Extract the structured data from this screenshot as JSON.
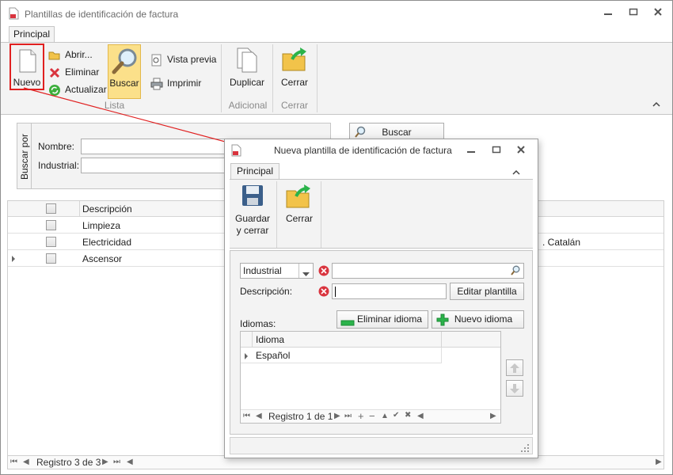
{
  "window": {
    "title": "Plantillas de identificación de factura"
  },
  "ribbon": {
    "tab": "Principal",
    "nuevo": "Nuevo",
    "abrir": "Abrir...",
    "eliminar": "Eliminar",
    "actualizar": "Actualizar",
    "buscar": "Buscar",
    "vista_previa": "Vista previa",
    "imprimir": "Imprimir",
    "duplicar": "Duplicar",
    "cerrar": "Cerrar",
    "group_lista": "Lista",
    "group_adicional": "Adicional",
    "group_cerrar": "Cerrar"
  },
  "search_panel": {
    "vertical_label": "Buscar por",
    "nombre_label": "Nombre:",
    "industrial_label": "Industrial:",
    "buscar_button": "Buscar",
    "nombre_value": "",
    "industrial_value": ""
  },
  "grid": {
    "header_descripcion": "Descripción",
    "rows": [
      {
        "descripcion": "Limpieza",
        "extra": ""
      },
      {
        "descripcion": "Electricidad",
        "extra": ". Catalán"
      },
      {
        "descripcion": "Ascensor",
        "extra": ""
      }
    ],
    "nav_text": "Registro 3 de 3"
  },
  "dialog": {
    "title": "Nueva plantilla de identificación de factura",
    "tab": "Principal",
    "guardar": "Guardar\ny cerrar",
    "cerrar": "Cerrar",
    "industrial_select": "Industrial",
    "descripcion_label": "Descripción:",
    "editar_plantilla": "Editar plantilla",
    "idiomas_label": "Idiomas:",
    "eliminar_idioma": "Eliminar idioma",
    "nuevo_idioma": "Nuevo idioma",
    "idioma_header": "Idioma",
    "idioma_rows": [
      "Español"
    ],
    "nav_text": "Registro 1 de 1"
  },
  "colors": {
    "highlight_box": "#e02020",
    "buscar_active": "#fbe08a",
    "error_icon": "#d9343e",
    "green": "#2bb34a"
  }
}
